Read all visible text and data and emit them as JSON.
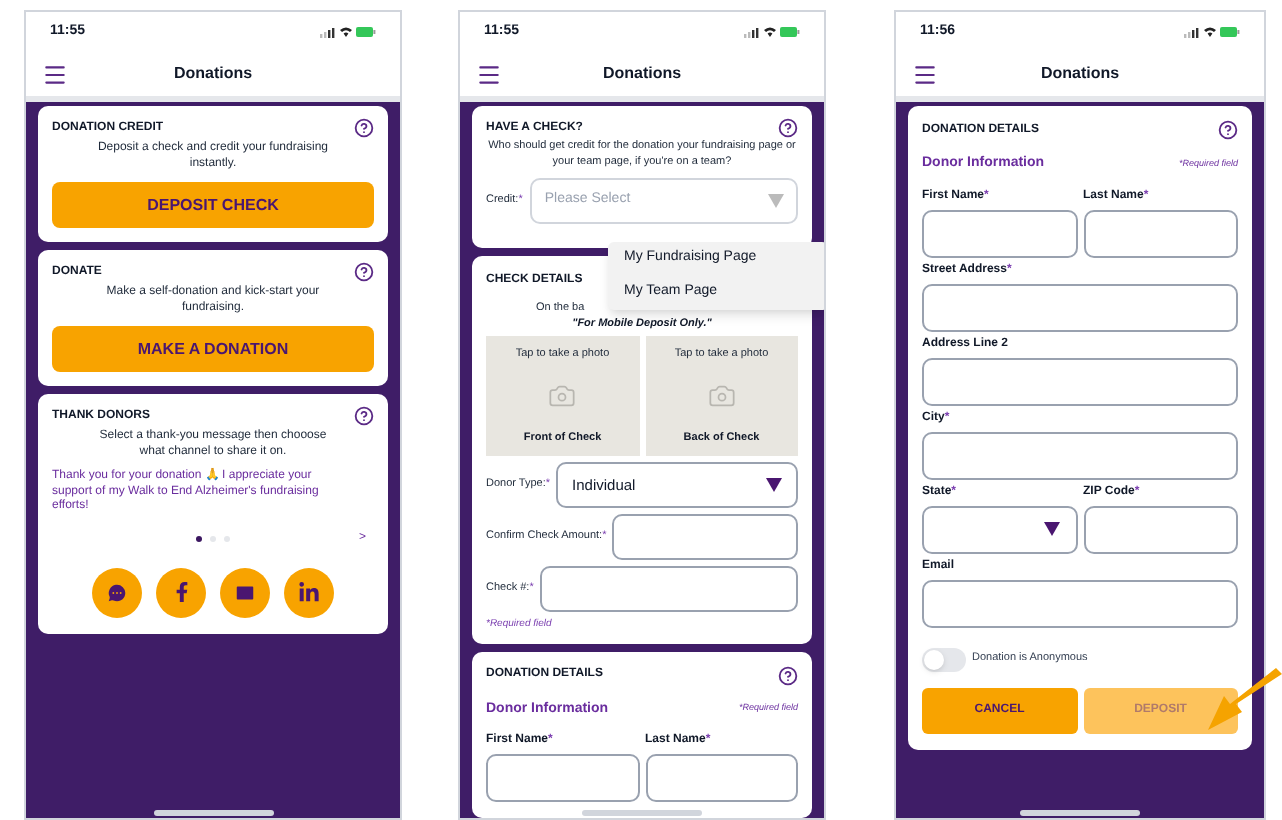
{
  "phones": [
    {
      "time": "11:55",
      "title": "Donations",
      "cards": [
        {
          "kind": "action",
          "title": "DONATION CREDIT",
          "text": "Deposit a check and credit your fundraising instantly.",
          "button": "DEPOSIT CHECK"
        },
        {
          "kind": "action",
          "title": "DONATE",
          "text": "Make a self-donation and kick-start your fundraising.",
          "button": "MAKE A DONATION"
        },
        {
          "kind": "thank",
          "title": "THANK DONORS",
          "text": "Select a thank-you message then chooose what channel to share it on.",
          "message": "Thank you for your donation 🙏 I appreciate your support of my Walk to End Alzheimer's fundraising efforts!",
          "dots": [
            {
              "selected": true
            },
            {
              "selected": false
            },
            {
              "selected": false
            }
          ],
          "next": ">",
          "share": [
            {
              "kind": "message"
            },
            {
              "kind": "facebook"
            },
            {
              "kind": "mail"
            },
            {
              "kind": "linkedin"
            }
          ]
        }
      ]
    },
    {
      "time": "11:55",
      "title": "Donations",
      "cards": [
        {
          "kind": "credit",
          "title": "HAVE A CHECK?",
          "text": "Who should get credit for the donation your fundraising page or your team page, if you're on a team?",
          "label": "Credit:",
          "mark": "*",
          "placeholder": "Please Select",
          "options": [
            "My Fundraising Page",
            "My Team Page"
          ]
        },
        {
          "kind": "check",
          "title": "CHECK DETAILS",
          "text": "On the ba",
          "note": "\"For Mobile Deposit Only.\"",
          "photos": [
            {
              "hint": "Tap to take a photo",
              "label": "Front of Check"
            },
            {
              "hint": "Tap to take a photo",
              "label": "Back of Check"
            }
          ],
          "inputs": [
            {
              "kind": "select",
              "label": "Donor Type:",
              "mark": "*",
              "value": "Individual"
            },
            {
              "kind": "text",
              "label": "Confirm Check Amount:",
              "mark": "*"
            },
            {
              "kind": "text",
              "label": "Check #:",
              "mark": "*"
            }
          ],
          "required": "*Required field"
        },
        {
          "kind": "details",
          "title": "DONATION DETAILS",
          "subtitle": "Donor Information",
          "required": "*Required field",
          "rows": [
            {
              "fields": [
                {
                  "kind": "text",
                  "label": "First Name",
                  "mark": "*"
                },
                {
                  "kind": "text",
                  "label": "Last Name",
                  "mark": "*"
                }
              ]
            }
          ]
        }
      ]
    },
    {
      "time": "11:56",
      "title": "Donations",
      "cards": [
        {
          "kind": "details",
          "title": "DONATION DETAILS",
          "subtitle": "Donor Information",
          "required": "*Required field",
          "rows": [
            {
              "fields": [
                {
                  "kind": "text",
                  "label": "First Name",
                  "mark": "*"
                },
                {
                  "kind": "text",
                  "label": "Last Name",
                  "mark": "*"
                }
              ]
            },
            {
              "fields": [
                {
                  "kind": "text",
                  "label": "Street Address",
                  "mark": "*"
                }
              ]
            },
            {
              "fields": [
                {
                  "kind": "text",
                  "label": "Address Line 2"
                }
              ]
            },
            {
              "fields": [
                {
                  "kind": "text",
                  "label": "City",
                  "mark": "*"
                }
              ]
            },
            {
              "fields": [
                {
                  "kind": "select",
                  "label": "State",
                  "mark": "*"
                },
                {
                  "kind": "text",
                  "label": "ZIP Code",
                  "mark": "*"
                }
              ]
            },
            {
              "fields": [
                {
                  "kind": "text",
                  "label": "Email"
                }
              ]
            }
          ],
          "toggle": {
            "label": "Donation is Anonymous",
            "on": false
          },
          "buttons": [
            {
              "label": "CANCEL",
              "disabled": false
            },
            {
              "label": "DEPOSIT",
              "disabled": true
            }
          ]
        }
      ]
    }
  ]
}
